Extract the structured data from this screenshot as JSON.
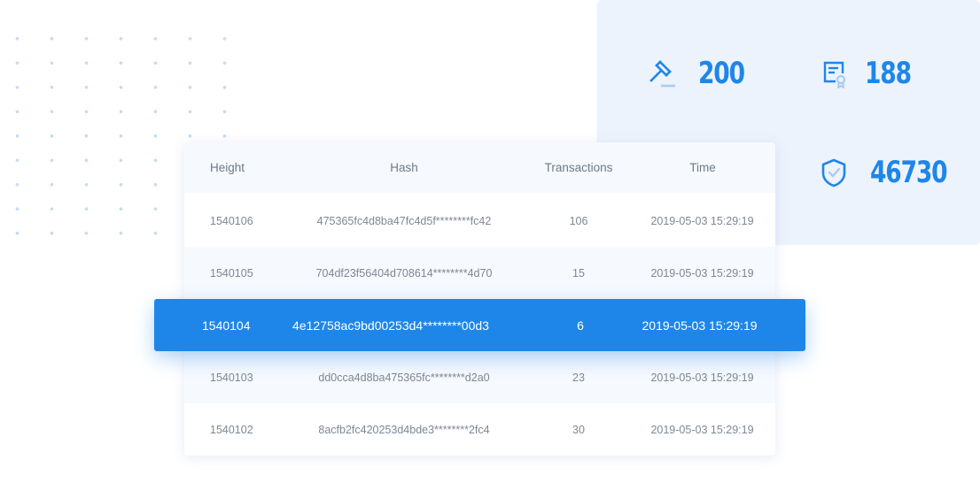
{
  "stats": {
    "gavel_value": "200",
    "certificate_value": "188",
    "shield_value": "46730",
    "accent_color": "#1f86e9",
    "icons": [
      "gavel-icon",
      "certificate-icon",
      "shield-check-icon"
    ]
  },
  "table": {
    "headers": [
      "Height",
      "Hash",
      "Transactions",
      "Time"
    ],
    "rows": [
      {
        "height": "1540106",
        "hash": "475365fc4d8ba47fc4d5f********fc42",
        "transactions": "106",
        "time": "2019-05-03 15:29:19"
      },
      {
        "height": "1540105",
        "hash": "704df23f56404d708614********4d70",
        "transactions": "15",
        "time": "2019-05-03 15:29:19"
      },
      {
        "height": "1540104",
        "hash": "4e12758ac9bd00253d4********00d3",
        "transactions": "6",
        "time": "2019-05-03 15:29:19",
        "highlighted": true
      },
      {
        "height": "1540103",
        "hash": "dd0cca4d8ba475365fc********d2a0",
        "transactions": "23",
        "time": "2019-05-03 15:29:19"
      },
      {
        "height": "1540102",
        "hash": "8acfb2fc420253d4bde3********2fc4",
        "transactions": "30",
        "time": "2019-05-03 15:29:19"
      }
    ]
  }
}
